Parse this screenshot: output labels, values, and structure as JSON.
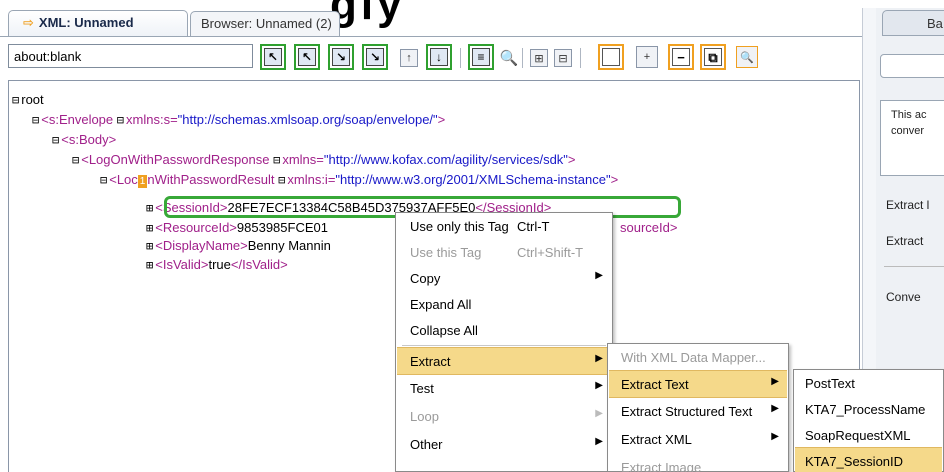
{
  "tabs": {
    "active_label": "XML: Unnamed",
    "inactive_label": "Browser: Unnamed (2)"
  },
  "toolbar": {
    "url": "about:blank"
  },
  "tree": {
    "root": "root",
    "envelope": {
      "tag": "<s:Envelope",
      "attr": "xmlns:s=",
      "val": "\"http://schemas.xmlsoap.org/soap/envelope/\"",
      "close": ">"
    },
    "body": "<s:Body>",
    "response": {
      "tag": "<LogOnWithPasswordResponse",
      "attr": "xmlns=",
      "val": "\"http://www.kofax.com/agility/services/sdk\"",
      "close": ">"
    },
    "result": {
      "tag_a": "<Loc",
      "badge": "1",
      "tag_b": "nWithPasswordResult",
      "attr": "xmlns:i=",
      "val": "\"http://www.w3.org/2001/XMLSchema-instance\"",
      "close": ">"
    },
    "session": {
      "open": "<SessionId>",
      "value": "28FE7ECF13384C58B45D375937AFF5E0",
      "close": "</SessionId>"
    },
    "resource": {
      "open": "<ResourceId>",
      "value": "9853985FCE01",
      "close": "sourceId>"
    },
    "display": {
      "open": "<DisplayName>",
      "value": "Benny Mannin"
    },
    "valid": {
      "open": "<IsValid>",
      "value": "true",
      "close": "</IsValid>"
    }
  },
  "context_menu": {
    "items": [
      {
        "label": "Use only this Tag",
        "shortcut": "Ctrl-T"
      },
      {
        "label": "Use this Tag",
        "shortcut": "Ctrl+Shift-T"
      },
      {
        "label": "Copy"
      },
      {
        "label": "Expand All"
      },
      {
        "label": "Collapse All"
      },
      {
        "label": "Extract"
      },
      {
        "label": "Test"
      },
      {
        "label": "Loop"
      },
      {
        "label": "Other"
      }
    ]
  },
  "extract_menu": {
    "items": [
      {
        "label": "With XML Data Mapper..."
      },
      {
        "label": "Extract Text"
      },
      {
        "label": "Extract Structured Text"
      },
      {
        "label": "Extract XML"
      },
      {
        "label": "Extract Image"
      }
    ]
  },
  "variables_menu": {
    "items": [
      {
        "label": "PostText"
      },
      {
        "label": "KTA7_ProcessName"
      },
      {
        "label": "SoapRequestXML"
      },
      {
        "label": "KTA7_SessionID"
      }
    ]
  },
  "right_panel": {
    "tab": "Ba",
    "desc_line1": "This ac",
    "desc_line2": "conver",
    "label1": "Extract l",
    "label2": "Extract",
    "label3": "Conve"
  },
  "top_partial_text": "gly"
}
